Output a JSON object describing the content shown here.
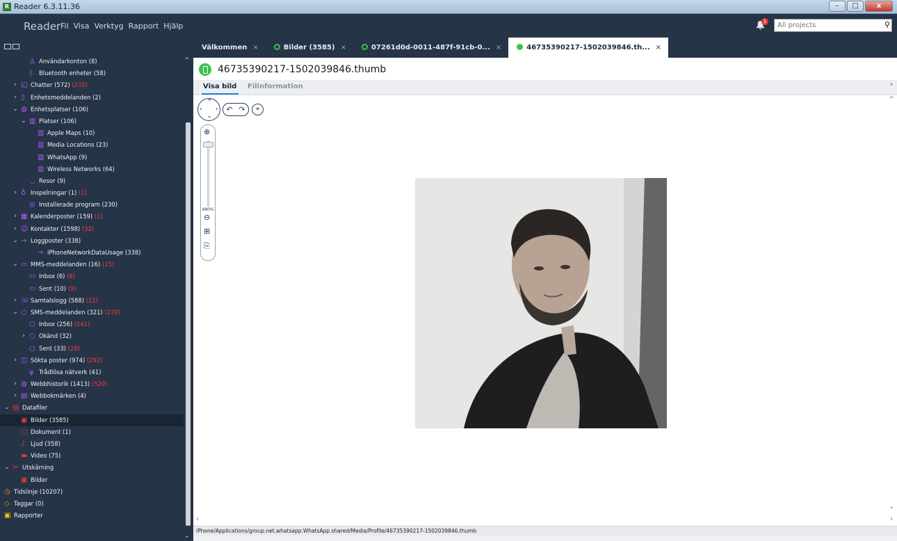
{
  "window": {
    "title": "Reader 6.3.11.36",
    "app_icon": "R",
    "buttons": {
      "minimize": "–",
      "maximize": "□",
      "close": "x"
    }
  },
  "app": {
    "brand": "Reader",
    "menu": [
      "Fil",
      "Visa",
      "Verktyg",
      "Rapport",
      "Hjälp"
    ],
    "notifications": "1",
    "search_placeholder": "All projects"
  },
  "colors": {
    "accent_green": "#3cc24a",
    "sidebar_bg": "#253447",
    "count_red": "#ff3b3b",
    "tab_underline": "#1e88e5"
  },
  "tree": [
    {
      "depth": 1,
      "chev": "",
      "icon": "user-icon",
      "color": "#b35cff",
      "label": "Användarkonton (8)",
      "count": ""
    },
    {
      "depth": 1,
      "chev": "",
      "icon": "bluetooth-icon",
      "color": "#b35cff",
      "label": "Bluetooth enheter (58)",
      "count": ""
    },
    {
      "depth": 0,
      "chev": "›",
      "icon": "chat-icon",
      "color": "#b35cff",
      "label": "Chatter (572)",
      "count": "(232)"
    },
    {
      "depth": 0,
      "chev": "›",
      "icon": "notification-icon",
      "color": "#b35cff",
      "label": "Enhetsmeddelanden (2)",
      "count": ""
    },
    {
      "depth": 0,
      "chev": "⌄",
      "icon": "globe-icon",
      "color": "#b35cff",
      "label": "Enhetsplatser (106)",
      "count": ""
    },
    {
      "depth": 1,
      "chev": "⌄",
      "icon": "map-icon",
      "color": "#b35cff",
      "label": "Platser (106)",
      "count": ""
    },
    {
      "depth": 2,
      "chev": "",
      "icon": "map-icon",
      "color": "#b35cff",
      "label": "Apple Maps (10)",
      "count": ""
    },
    {
      "depth": 2,
      "chev": "",
      "icon": "map-icon",
      "color": "#b35cff",
      "label": "Media Locations (23)",
      "count": ""
    },
    {
      "depth": 2,
      "chev": "",
      "icon": "map-icon",
      "color": "#b35cff",
      "label": "WhatsApp (9)",
      "count": ""
    },
    {
      "depth": 2,
      "chev": "",
      "icon": "map-icon",
      "color": "#b35cff",
      "label": "Wireless Networks (64)",
      "count": ""
    },
    {
      "depth": 1,
      "chev": "",
      "icon": "journey-icon",
      "color": "#b35cff",
      "label": "Resor (9)",
      "count": ""
    },
    {
      "depth": 0,
      "chev": "›",
      "icon": "microphone-icon",
      "color": "#b35cff",
      "label": "Inspelningar (1)",
      "count": "(1)"
    },
    {
      "depth": 1,
      "chev": "",
      "icon": "app-icon",
      "color": "#b35cff",
      "label": "Installerade program (230)",
      "count": ""
    },
    {
      "depth": 0,
      "chev": "›",
      "icon": "calendar-icon",
      "color": "#b35cff",
      "label": "Kalenderposter (159)",
      "count": "(1)"
    },
    {
      "depth": 0,
      "chev": "›",
      "icon": "contact-icon",
      "color": "#b35cff",
      "label": "Kontakter (1598)",
      "count": "(32)"
    },
    {
      "depth": 0,
      "chev": "⌄",
      "icon": "log-icon",
      "color": "#b35cff",
      "label": "Loggposter (338)",
      "count": ""
    },
    {
      "depth": 2,
      "chev": "",
      "icon": "log-icon",
      "color": "#b35cff",
      "label": "iPhoneNetworkDataUsage (338)",
      "count": ""
    },
    {
      "depth": 0,
      "chev": "⌄",
      "icon": "mms-icon",
      "color": "#b35cff",
      "label": "MMS-meddelanden (16)",
      "count": "(15)"
    },
    {
      "depth": 1,
      "chev": "",
      "icon": "mms-icon",
      "color": "#b35cff",
      "label": "Inbox (6)",
      "count": "(6)"
    },
    {
      "depth": 1,
      "chev": "",
      "icon": "mms-icon",
      "color": "#b35cff",
      "label": "Sent (10)",
      "count": "(9)"
    },
    {
      "depth": 0,
      "chev": "›",
      "icon": "phone-icon",
      "color": "#b35cff",
      "label": "Samtalslogg (588)",
      "count": "(22)"
    },
    {
      "depth": 0,
      "chev": "⌄",
      "icon": "sms-icon",
      "color": "#b35cff",
      "label": "SMS-meddelanden (321)",
      "count": "(270)"
    },
    {
      "depth": 1,
      "chev": "",
      "icon": "sms-icon",
      "color": "#b35cff",
      "label": "Inbox (256)",
      "count": "(241)"
    },
    {
      "depth": 1,
      "chev": "›",
      "icon": "sms-icon",
      "color": "#b35cff",
      "label": "Okänd (32)",
      "count": ""
    },
    {
      "depth": 1,
      "chev": "",
      "icon": "sms-icon",
      "color": "#b35cff",
      "label": "Sent (33)",
      "count": "(29)"
    },
    {
      "depth": 0,
      "chev": "›",
      "icon": "search-entry-icon",
      "color": "#b35cff",
      "label": "Sökta poster (974)",
      "count": "(292)"
    },
    {
      "depth": 1,
      "chev": "",
      "icon": "wifi-icon",
      "color": "#b35cff",
      "label": "Trådlösa nätverk (41)",
      "count": ""
    },
    {
      "depth": 0,
      "chev": "›",
      "icon": "globe-icon",
      "color": "#b35cff",
      "label": "Webbhistorik (1413)",
      "count": "(520)"
    },
    {
      "depth": 0,
      "chev": "›",
      "icon": "bookmark-icon",
      "color": "#b35cff",
      "label": "Webbokmärken (4)",
      "count": ""
    },
    {
      "depth": -1,
      "chev": "⌄",
      "icon": "datafiles-icon",
      "color": "#e53935",
      "label": "Datafiler",
      "count": ""
    },
    {
      "depth": 0,
      "chev": "",
      "icon": "image-icon",
      "color": "#e53935",
      "label": "Bilder (3585)",
      "count": "",
      "selected": true
    },
    {
      "depth": 0,
      "chev": "",
      "icon": "document-icon",
      "color": "#e53935",
      "label": "Dokument (1)",
      "count": ""
    },
    {
      "depth": 0,
      "chev": "",
      "icon": "audio-icon",
      "color": "#e53935",
      "label": "Ljud (358)",
      "count": ""
    },
    {
      "depth": 0,
      "chev": "",
      "icon": "video-icon",
      "color": "#e53935",
      "label": "Video (75)",
      "count": ""
    },
    {
      "depth": -1,
      "chev": "⌄",
      "icon": "carving-icon",
      "color": "#e53935",
      "label": "Utskärning",
      "count": ""
    },
    {
      "depth": 0,
      "chev": "",
      "icon": "image-icon",
      "color": "#e53935",
      "label": "Bilder",
      "count": ""
    },
    {
      "depth": -2,
      "chev": "",
      "icon": "clock-icon",
      "color": "#f39c12",
      "label": "Tidslinje (10207)",
      "count": ""
    },
    {
      "depth": -2,
      "chev": "",
      "icon": "tag-icon",
      "color": "#f39c12",
      "label": "Taggar (0)",
      "count": ""
    },
    {
      "depth": -2,
      "chev": "",
      "icon": "report-icon",
      "color": "#f1c40f",
      "label": "Rapporter",
      "count": ""
    }
  ],
  "tabs": [
    {
      "label": "Välkommen",
      "dot": "none",
      "active": false
    },
    {
      "label": "Bilder (3585)",
      "dot": "ring",
      "active": false
    },
    {
      "label": "07261d0d-0011-487f-91cb-0...",
      "dot": "ring",
      "active": false
    },
    {
      "label": "46735390217-1502039846.th...",
      "dot": "fill",
      "active": true
    }
  ],
  "document": {
    "title": "46735390217-1502039846.thumb",
    "subtabs": [
      "Visa bild",
      "Filinformation"
    ],
    "zoom_label": "480%",
    "path": "iPhone/Applications/group.net.whatsapp.WhatsApp.shared/Media/Profile/46735390217-1502039846.thumb"
  }
}
